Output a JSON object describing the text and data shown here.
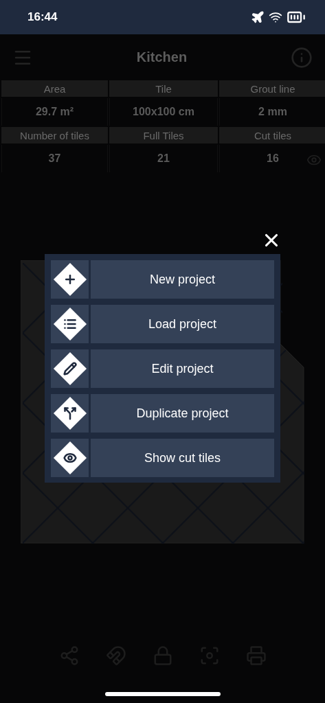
{
  "status_bar": {
    "time": "16:44"
  },
  "header": {
    "title": "Kitchen"
  },
  "stats": [
    {
      "cells": [
        {
          "label": "Area",
          "value": "29.7 m²"
        },
        {
          "label": "Tile",
          "value": "100x100 cm"
        },
        {
          "label": "Grout line",
          "value": "2 mm"
        }
      ]
    },
    {
      "cells": [
        {
          "label": "Number of tiles",
          "value": "37"
        },
        {
          "label": "Full Tiles",
          "value": "21"
        },
        {
          "label": "Cut tiles",
          "value": "16",
          "kind": "eye"
        }
      ]
    }
  ],
  "menu": {
    "items": [
      {
        "label": "New project",
        "kind": "new"
      },
      {
        "label": "Load project",
        "kind": "load"
      },
      {
        "label": "Edit project",
        "kind": "edit"
      },
      {
        "label": "Duplicate project",
        "kind": "duplicate"
      },
      {
        "label": "Show cut tiles",
        "kind": "show"
      }
    ]
  },
  "toolbar": {
    "items": [
      {
        "kind": "share"
      },
      {
        "kind": "magnet"
      },
      {
        "kind": "lock"
      },
      {
        "kind": "focus"
      },
      {
        "kind": "print"
      }
    ]
  }
}
